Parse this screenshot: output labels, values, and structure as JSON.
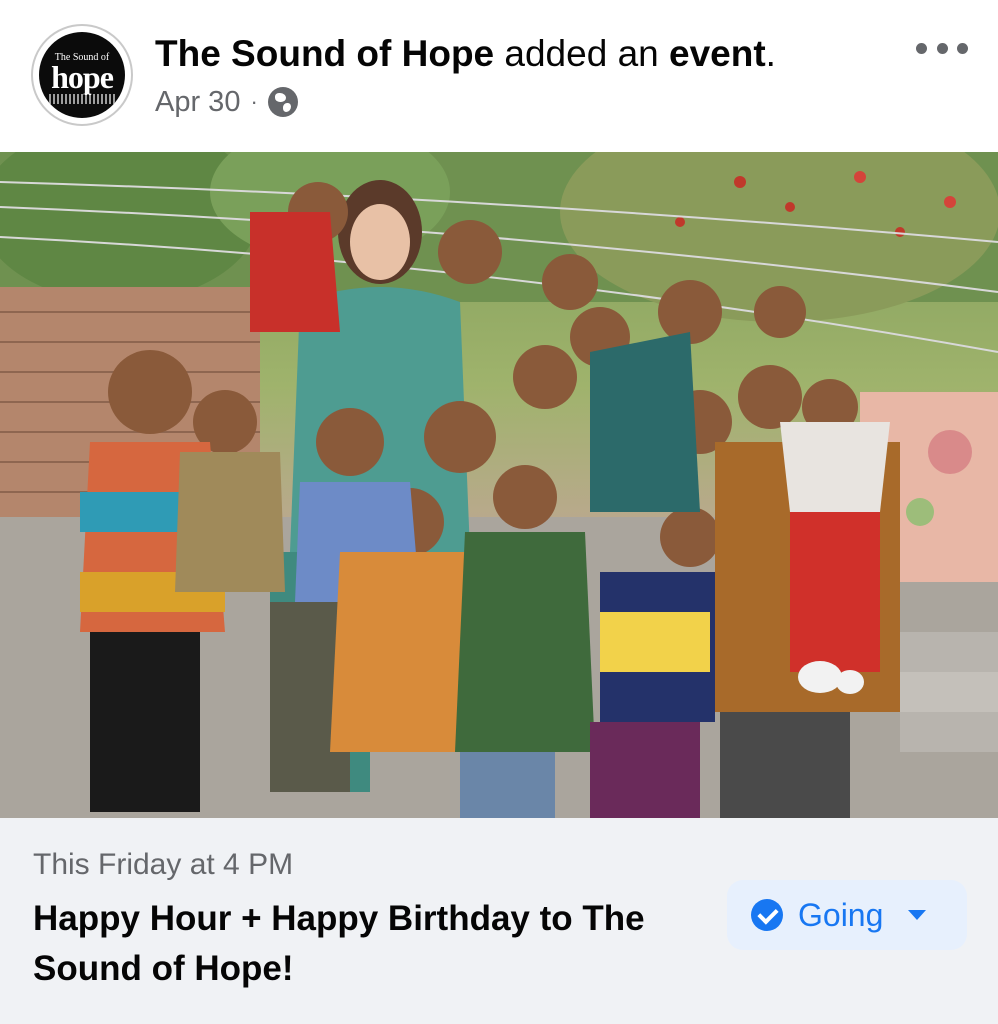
{
  "post": {
    "page_name": "The Sound of Hope",
    "action_text": "added an",
    "action_object": "event",
    "action_period": ".",
    "timestamp": "Apr 30",
    "separator": "·",
    "audience_icon": "globe-icon",
    "more_icon": "more-horizontal-icon"
  },
  "avatar": {
    "logo_small_text": "The Sound of",
    "logo_big_text": "hope"
  },
  "photo": {
    "subject": "group-photo"
  },
  "event": {
    "date_text": "This Friday at 4 PM",
    "title": "Happy Hour + Happy Birthday to The Sound of Hope!",
    "rsvp_label": "Going",
    "rsvp_icon": "check-circle-icon",
    "dropdown_icon": "caret-down-icon"
  },
  "colors": {
    "accent": "#1877f2",
    "rsvp_background": "#e7f0fd",
    "secondary_text": "#65676b",
    "info_background": "#f0f2f5"
  }
}
